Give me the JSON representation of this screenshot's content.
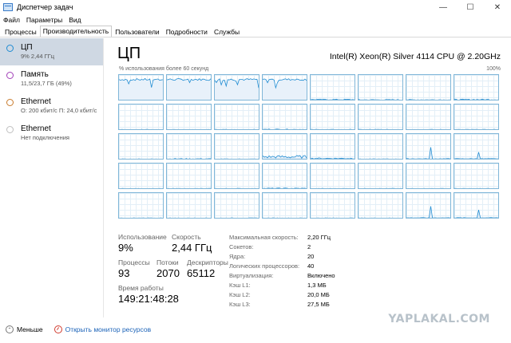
{
  "window": {
    "title": "Диспетчер задач",
    "minimize_glyph": "—",
    "maximize_glyph": "☐",
    "close_glyph": "✕"
  },
  "menu": [
    "Файл",
    "Параметры",
    "Вид"
  ],
  "tabs": [
    {
      "label": "Процессы",
      "active": false
    },
    {
      "label": "Производительность",
      "active": true
    },
    {
      "label": "Пользователи",
      "active": false
    },
    {
      "label": "Подробности",
      "active": false
    },
    {
      "label": "Службы",
      "active": false
    }
  ],
  "sidebar": [
    {
      "title": "ЦП",
      "subtitle": "9% 2,44 ГГц",
      "color": "#1e8bd2",
      "selected": true
    },
    {
      "title": "Память",
      "subtitle": "11,5/23,7 ГБ (49%)",
      "color": "#a23fb8",
      "selected": false
    },
    {
      "title": "Ethernet",
      "subtitle": "О: 200 кбит/с П: 24,0 кбит/с",
      "color": "#c87a2a",
      "selected": false
    },
    {
      "title": "Ethernet",
      "subtitle": "Нет подключения",
      "color": "#bfbfbf",
      "selected": false
    }
  ],
  "main": {
    "title": "ЦП",
    "cpu_model": "Intel(R) Xeon(R) Silver 4114 CPU @ 2.20GHz",
    "usage_caption": "% использования более 60 секунд",
    "usage_max": "100%"
  },
  "graph_colors": {
    "line": "#1e8bd2",
    "border": "#7fb6d8",
    "fill": "#e8f1fa"
  },
  "core_levels": [
    0.85,
    0.85,
    0.85,
    0.85,
    0.04,
    0.03,
    0.03,
    0.04,
    0.02,
    0.02,
    0.02,
    0.03,
    0.02,
    0.02,
    0.02,
    0.02,
    0.02,
    0.03,
    0.02,
    0.12,
    0.05,
    0.02,
    0.5,
    0.3,
    0.02,
    0.02,
    0.02,
    0.03,
    0.02,
    0.02,
    0.02,
    0.02,
    0.02,
    0.02,
    0.02,
    0.02,
    0.02,
    0.02,
    0.5,
    0.35
  ],
  "stats": {
    "usage_label": "Использование",
    "usage_value": "9%",
    "speed_label": "Скорость",
    "speed_value": "2,44 ГГц",
    "processes_label": "Процессы",
    "processes_value": "93",
    "threads_label": "Потоки",
    "threads_value": "2070",
    "handles_label": "Дескрипторы",
    "handles_value": "65112",
    "uptime_label": "Время работы",
    "uptime_value": "149:21:48:28"
  },
  "info": [
    {
      "key": "Максимальная скорость:",
      "value": "2,20 ГГц"
    },
    {
      "key": "Сокетов:",
      "value": "2"
    },
    {
      "key": "Ядра:",
      "value": "20"
    },
    {
      "key": "Логических процессоров:",
      "value": "40"
    },
    {
      "key": "Виртуализация:",
      "value": "Включено"
    },
    {
      "key": "Кэш L1:",
      "value": "1,3 МБ"
    },
    {
      "key": "Кэш L2:",
      "value": "20,0 МБ"
    },
    {
      "key": "Кэш L3:",
      "value": "27,5 МБ"
    }
  ],
  "footer": {
    "fewer_label": "Меньше",
    "monitor_label": "Открыть монитор ресурсов"
  },
  "watermark": "YAPLAKAL.COM"
}
